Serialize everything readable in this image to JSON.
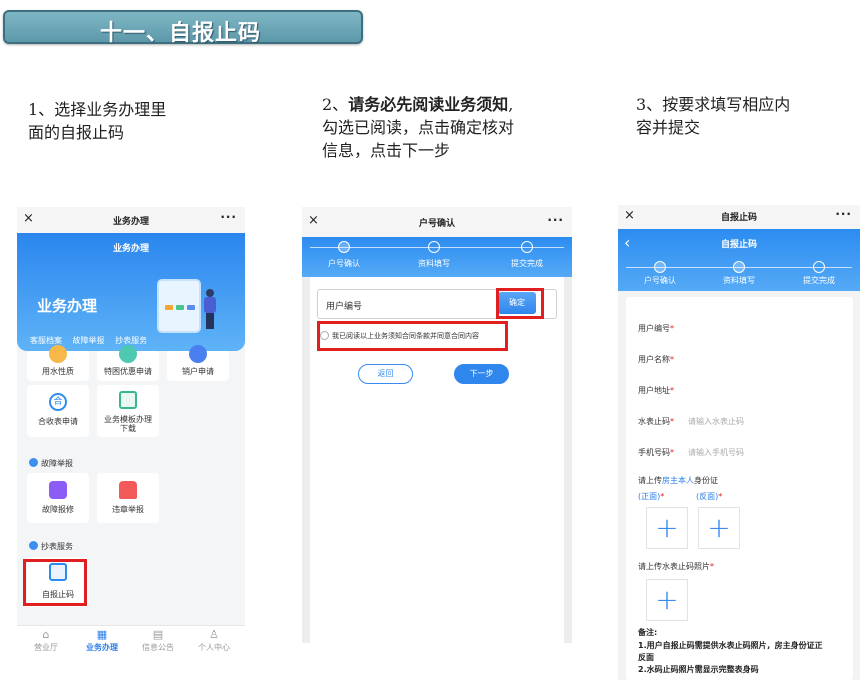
{
  "banner": {
    "title": "十一、自报止码"
  },
  "steps": [
    {
      "num": "1、",
      "text": "选择业务办理里",
      "text2": "面的自报止码"
    },
    {
      "num": "2、",
      "bold": "请务必先阅读业务须知",
      "after_bold": ",",
      "text2": "勾选已阅读，点击确定核对",
      "text3": "信息，点击下一步"
    },
    {
      "num": "3、",
      "text": "按要求填写相应内",
      "text2": "容并提交"
    }
  ],
  "phone1": {
    "close": "×",
    "title": "业务办理",
    "more": "···",
    "header_title": "业务办理",
    "banner_text": "业务办理",
    "tabs": [
      "客服档案",
      "故障举报",
      "抄表服务"
    ],
    "cards_row1": [
      "用水性质",
      "特困优惠申请",
      "销户申请"
    ],
    "cards_row2": [
      "合收表申请",
      "业务模板办理",
      "下载"
    ],
    "section_fault": "故障举报",
    "cards_fault": [
      "故障报修",
      "违章举报"
    ],
    "section_meter": "抄表服务",
    "card_meter": "自报止码",
    "nav": [
      "营业厅",
      "业务办理",
      "信息公告",
      "个人中心"
    ]
  },
  "phone2": {
    "close": "×",
    "title": "户号确认",
    "more": "···",
    "steps": [
      "户号确认",
      "资料填写",
      "提交完成"
    ],
    "input_placeholder": "用户编号",
    "confirm": "确定",
    "agree": "我已阅读以上业务须知合同条款并同意合同内容",
    "back": "返回",
    "next": "下一步"
  },
  "phone3": {
    "close": "×",
    "title": "自报止码",
    "more": "···",
    "header_title": "自报止码",
    "back_icon": "‹",
    "steps": [
      "户号确认",
      "资料填写",
      "提交完成"
    ],
    "fields": [
      {
        "label": "用户编号",
        "req": "*",
        "placeholder": ""
      },
      {
        "label": "用户名称",
        "req": "*",
        "placeholder": ""
      },
      {
        "label": "用户地址",
        "req": "*",
        "placeholder": ""
      },
      {
        "label": "水表止码",
        "req": "*",
        "placeholder": "请输入水表止码"
      },
      {
        "label": "手机号码",
        "req": "*",
        "placeholder": "请输入手机号码"
      }
    ],
    "upload_id": {
      "pre": "请上传",
      "highlight": "房主本人",
      "post": "身份证"
    },
    "front": "(正面)",
    "back": "(反面)",
    "req": "*",
    "upload_meter": "请上传水表止码照片",
    "plus": "+",
    "note_title": "备注:",
    "note1": "1.用户自报止码需提供水表止码照片，房主身份证正",
    "note1b": "反面",
    "note2": "2.水码止码照片需显示完整表身码"
  }
}
